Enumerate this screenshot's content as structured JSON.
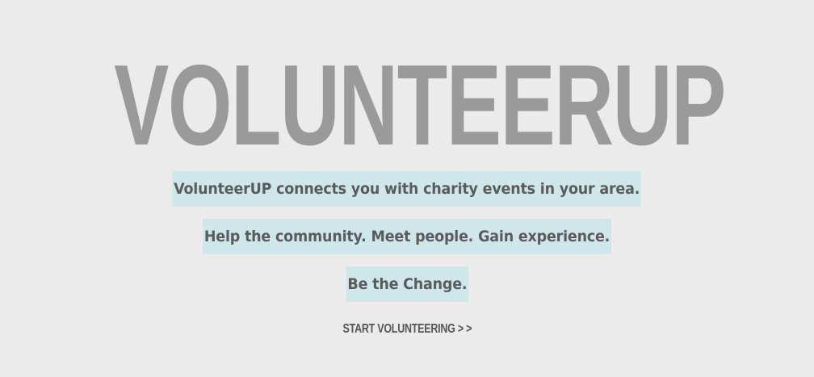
{
  "hero": {
    "title": "VOLUNTEERUP",
    "taglines": [
      "VolunteerUP connects you with charity events in your area.",
      "Help the community. Meet people. Gain experience.",
      "Be the Change."
    ],
    "cta_label": "START VOLUNTEERING > >"
  },
  "colors": {
    "background": "#ebebeb",
    "title": "#9a9a9a",
    "tagline_highlight": "#cfe7ea",
    "tagline_text": "#5b5b5b",
    "cta_text": "#555555"
  }
}
